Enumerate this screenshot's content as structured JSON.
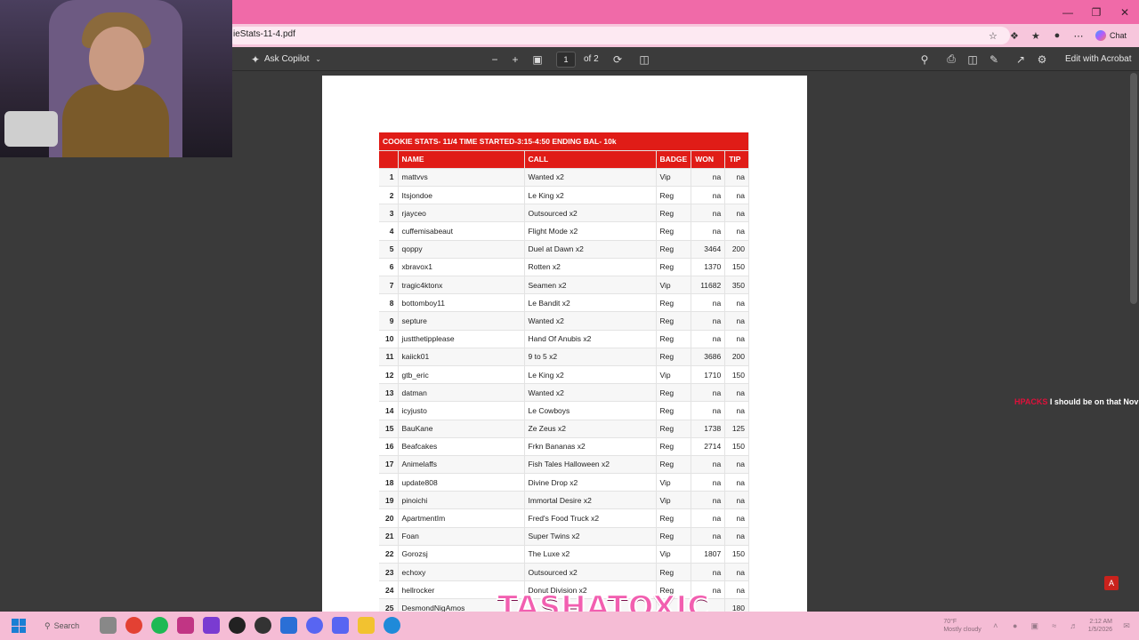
{
  "browser": {
    "url": "ieStats-11-4.pdf",
    "chat_label": "Chat"
  },
  "pdf_toolbar": {
    "copilot_label": "Ask Copilot",
    "page_current": "1",
    "page_total": "of 2",
    "edit_label": "Edit with Acrobat"
  },
  "document": {
    "title": "COOKIE STATS- 11/4 TIME STARTED-3:15-4:50  ENDING BAL- 10k",
    "headers": {
      "num": "",
      "name": "NAME",
      "call": "CALL",
      "badge": "BADGE",
      "won": "WON",
      "tip": "TIP"
    },
    "rows": [
      {
        "n": "1",
        "name": "mattvvs",
        "call": "Wanted x2",
        "badge": "Vip",
        "won": "na",
        "tip": "na"
      },
      {
        "n": "2",
        "name": "Itsjondoe",
        "call": "Le King x2",
        "badge": "Reg",
        "won": "na",
        "tip": "na"
      },
      {
        "n": "3",
        "name": "rjayceo",
        "call": "Outsourced x2",
        "badge": "Reg",
        "won": "na",
        "tip": "na"
      },
      {
        "n": "4",
        "name": "cuffemisabeaut",
        "call": "Flight Mode x2",
        "badge": "Reg",
        "won": "na",
        "tip": "na"
      },
      {
        "n": "5",
        "name": "qoppy",
        "call": "Duel at Dawn x2",
        "badge": "Reg",
        "won": "3464",
        "tip": "200"
      },
      {
        "n": "6",
        "name": "xbravox1",
        "call": "Rotten x2",
        "badge": "Reg",
        "won": "1370",
        "tip": "150"
      },
      {
        "n": "7",
        "name": "tragic4ktonx",
        "call": "Seamen x2",
        "badge": "Vip",
        "won": "11682",
        "tip": "350"
      },
      {
        "n": "8",
        "name": "bottomboy11",
        "call": "Le Bandit x2",
        "badge": "Reg",
        "won": "na",
        "tip": "na"
      },
      {
        "n": "9",
        "name": "septure",
        "call": "Wanted x2",
        "badge": "Reg",
        "won": "na",
        "tip": "na"
      },
      {
        "n": "10",
        "name": "justthetipplease",
        "call": "Hand Of Anubis x2",
        "badge": "Reg",
        "won": "na",
        "tip": "na"
      },
      {
        "n": "11",
        "name": "kaiick01",
        "call": "9 to 5 x2",
        "badge": "Reg",
        "won": "3686",
        "tip": "200"
      },
      {
        "n": "12",
        "name": "gtb_eric",
        "call": "Le King x2",
        "badge": "Vip",
        "won": "1710",
        "tip": "150"
      },
      {
        "n": "13",
        "name": "datman",
        "call": "Wanted x2",
        "badge": "Reg",
        "won": "na",
        "tip": "na"
      },
      {
        "n": "14",
        "name": "icyjusto",
        "call": "Le Cowboys",
        "badge": "Reg",
        "won": "na",
        "tip": "na"
      },
      {
        "n": "15",
        "name": "BauKane",
        "call": "Ze Zeus x2",
        "badge": "Reg",
        "won": "1738",
        "tip": "125"
      },
      {
        "n": "16",
        "name": "Beafcakes",
        "call": "Frkn Bananas x2",
        "badge": "Reg",
        "won": "2714",
        "tip": "150"
      },
      {
        "n": "17",
        "name": "Animelaffs",
        "call": "Fish Tales Halloween x2",
        "badge": "Reg",
        "won": "na",
        "tip": "na"
      },
      {
        "n": "18",
        "name": "update808",
        "call": "Divine Drop x2",
        "badge": "Vip",
        "won": "na",
        "tip": "na"
      },
      {
        "n": "19",
        "name": "pinoichi",
        "call": "Immortal Desire x2",
        "badge": "Vip",
        "won": "na",
        "tip": "na"
      },
      {
        "n": "20",
        "name": "ApartmentIm",
        "call": "Fred's Food Truck x2",
        "badge": "Reg",
        "won": "na",
        "tip": "na"
      },
      {
        "n": "21",
        "name": "Foan",
        "call": "Super Twins x2",
        "badge": "Reg",
        "won": "na",
        "tip": "na"
      },
      {
        "n": "22",
        "name": "Gorozsj",
        "call": "The Luxe x2",
        "badge": "Vip",
        "won": "1807",
        "tip": "150"
      },
      {
        "n": "23",
        "name": "echoxy",
        "call": "Outsourced x2",
        "badge": "Reg",
        "won": "na",
        "tip": "na"
      },
      {
        "n": "24",
        "name": "hellrocker",
        "call": "Donut Division x2",
        "badge": "Reg",
        "won": "na",
        "tip": "na"
      },
      {
        "n": "25",
        "name": "DesmondNigAmos",
        "call": "",
        "badge": "",
        "won": "",
        "tip": "180"
      }
    ]
  },
  "stream": {
    "chat_user": "HPACKS",
    "chat_message": "I should be on that Nov",
    "banner": "TASHATOXIC"
  },
  "taskbar": {
    "search_label": "Search",
    "weather_temp": "70°F",
    "weather_desc": "Mostly cloudy",
    "time": "2:12 AM",
    "date": "1/5/2026",
    "notification_count": "1"
  },
  "colors": {
    "titlebar": "#f06aa8",
    "table_header": "#e01c17",
    "taskbar": "#f5bcd5"
  }
}
